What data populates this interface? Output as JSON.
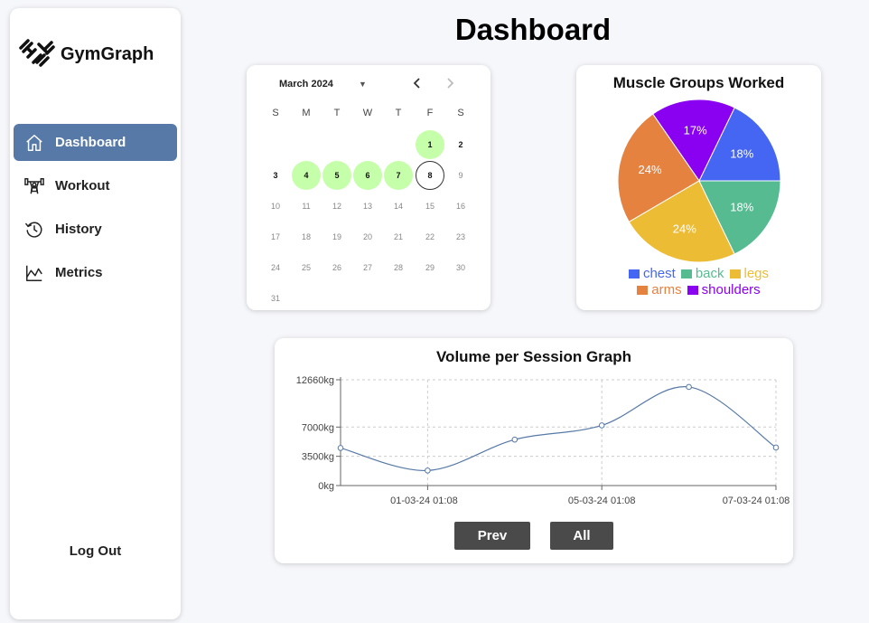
{
  "app": {
    "brand": "GymGraph",
    "page_title": "Dashboard"
  },
  "sidebar": {
    "items": [
      {
        "label": "Dashboard",
        "icon": "home-icon",
        "active": true
      },
      {
        "label": "Workout",
        "icon": "weightlifter-icon",
        "active": false
      },
      {
        "label": "History",
        "icon": "history-icon",
        "active": false
      },
      {
        "label": "Metrics",
        "icon": "chart-icon",
        "active": false
      }
    ],
    "logout_label": "Log Out",
    "active_color": "#5679a7"
  },
  "calendar": {
    "month_label": "March 2024",
    "weekdays": [
      "S",
      "M",
      "T",
      "W",
      "T",
      "F",
      "S"
    ],
    "days_in_month": 31,
    "first_weekday": 5,
    "current_through": 8,
    "workout_days": [
      1,
      4,
      5,
      6,
      7
    ],
    "today": 8,
    "highlight_color": "#c6ffa9"
  },
  "muscle_chart": {
    "title": "Muscle Groups Worked",
    "chart_data": {
      "type": "pie",
      "slices": [
        {
          "label": "chest",
          "value": 18,
          "color": "#4466f2"
        },
        {
          "label": "shoulders",
          "value": 17,
          "color": "#8a00f0"
        },
        {
          "label": "arms",
          "value": 24,
          "color": "#e68240"
        },
        {
          "label": "legs",
          "value": 24,
          "color": "#edbc35"
        },
        {
          "label": "back",
          "value": 18,
          "color": "#56bb91"
        }
      ],
      "legend_order": [
        "chest",
        "back",
        "legs",
        "arms",
        "shoulders"
      ],
      "value_suffix": "%"
    }
  },
  "volume_chart": {
    "title": "Volume per Session Graph",
    "chart_data": {
      "type": "line",
      "ylim": [
        0,
        12660
      ],
      "y_ticks": [
        {
          "value": 0,
          "label": "0kg"
        },
        {
          "value": 3500,
          "label": "3500kg"
        },
        {
          "value": 7000,
          "label": "7000kg"
        },
        {
          "value": 12660,
          "label": "12660kg"
        }
      ],
      "x_tick_labels": [
        "01-03-24 01:08",
        "05-03-24 01:08",
        "07-03-24 01:08"
      ],
      "series": [
        {
          "values": [
            4500,
            1800,
            5500,
            7200,
            11800,
            4550
          ],
          "color": "#5679a7"
        }
      ]
    },
    "prev_label": "Prev",
    "all_label": "All"
  }
}
